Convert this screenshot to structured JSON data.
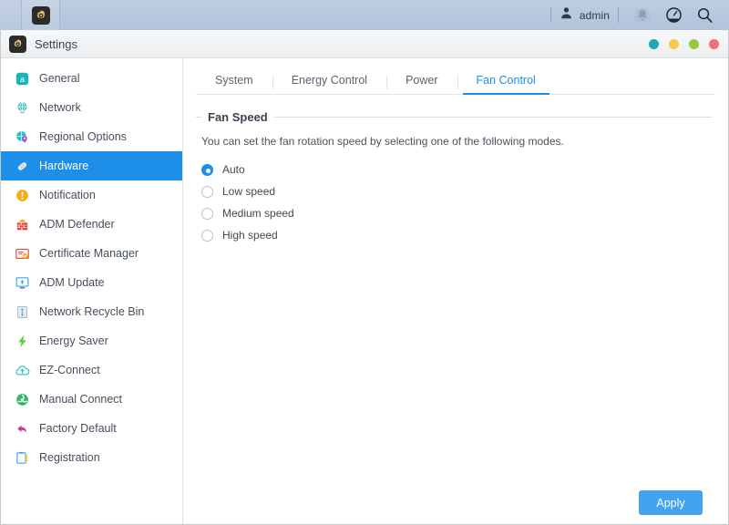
{
  "topbar": {
    "app_icon": "settings-gear-icon",
    "user": {
      "icon": "user-avatar-icon",
      "name": "admin"
    },
    "icons": [
      {
        "name": "notification-bell-icon",
        "label": "Notifications"
      },
      {
        "name": "dashboard-gauge-icon",
        "label": "Dashboard"
      },
      {
        "name": "search-icon",
        "label": "Search"
      }
    ]
  },
  "window": {
    "title": "Settings",
    "title_icon": "settings-gear-icon",
    "buttons": [
      {
        "name": "window-button-teal",
        "color": "#1fa8b8"
      },
      {
        "name": "window-button-yellow",
        "color": "#f5cb4a"
      },
      {
        "name": "window-button-green",
        "color": "#97c93d"
      },
      {
        "name": "window-button-red",
        "color": "#f47070"
      }
    ]
  },
  "sidebar": {
    "items": [
      {
        "label": "General",
        "icon": "general-icon",
        "active": false
      },
      {
        "label": "Network",
        "icon": "network-globe-icon",
        "active": false
      },
      {
        "label": "Regional Options",
        "icon": "regional-options-icon",
        "active": false
      },
      {
        "label": "Hardware",
        "icon": "hardware-icon",
        "active": true
      },
      {
        "label": "Notification",
        "icon": "notification-icon",
        "active": false
      },
      {
        "label": "ADM Defender",
        "icon": "adm-defender-icon",
        "active": false
      },
      {
        "label": "Certificate Manager",
        "icon": "certificate-manager-icon",
        "active": false
      },
      {
        "label": "ADM Update",
        "icon": "adm-update-icon",
        "active": false
      },
      {
        "label": "Network Recycle Bin",
        "icon": "network-recycle-bin-icon",
        "active": false
      },
      {
        "label": "Energy Saver",
        "icon": "energy-saver-icon",
        "active": false
      },
      {
        "label": "EZ-Connect",
        "icon": "ez-connect-icon",
        "active": false
      },
      {
        "label": "Manual Connect",
        "icon": "manual-connect-icon",
        "active": false
      },
      {
        "label": "Factory Default",
        "icon": "factory-default-icon",
        "active": false
      },
      {
        "label": "Registration",
        "icon": "registration-icon",
        "active": false
      }
    ]
  },
  "main": {
    "tabs": [
      {
        "label": "System",
        "active": false
      },
      {
        "label": "Energy Control",
        "active": false
      },
      {
        "label": "Power",
        "active": false
      },
      {
        "label": "Fan Control",
        "active": true
      }
    ],
    "section": {
      "legend": "Fan Speed",
      "description": "You can set the fan rotation speed by selecting one of the following modes.",
      "options": [
        {
          "label": "Auto",
          "selected": true
        },
        {
          "label": "Low speed",
          "selected": false
        },
        {
          "label": "Medium speed",
          "selected": false
        },
        {
          "label": "High speed",
          "selected": false
        }
      ]
    },
    "apply_label": "Apply"
  },
  "colors": {
    "accent": "#1e8fe8",
    "apply_button": "#44a3ee",
    "topbar": "#b9c9dd",
    "sidebar_active": "#1e8fe8"
  }
}
